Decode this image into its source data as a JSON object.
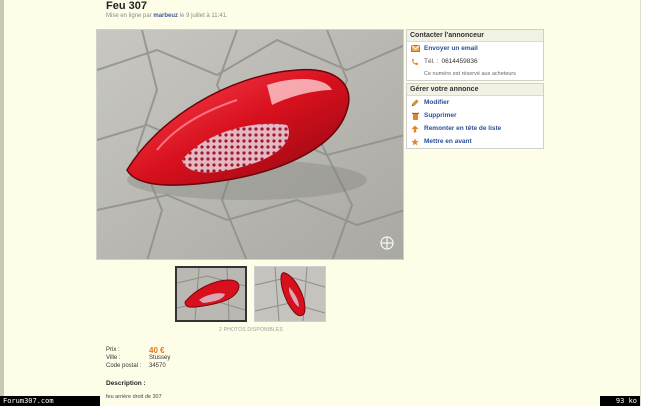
{
  "ad": {
    "title": "Feu 307",
    "meta_prefix": "Mise en ligne par",
    "seller": "marbeuz",
    "meta_suffix": "le 9 juillet à 11:41.",
    "photos_count": "2 PHOTOS DISPONIBLES"
  },
  "contact": {
    "heading": "Contacter l'annonceur",
    "email_label": "Envoyer un email",
    "phone_label": "Tél. :",
    "phone_number": "0614459836",
    "note": "Ce numéro est réservé aux acheteurs"
  },
  "manage": {
    "heading": "Gérer votre annonce",
    "items": [
      {
        "label": "Modifier",
        "icon": "pencil-icon"
      },
      {
        "label": "Supprimer",
        "icon": "trash-icon"
      },
      {
        "label": "Remonter en tête de liste",
        "icon": "up-arrow-icon"
      },
      {
        "label": "Mettre en avant",
        "icon": "star-icon"
      }
    ]
  },
  "details": {
    "price_label": "Prix :",
    "price_value": "40 €",
    "city_label": "Ville :",
    "city_value": "Stussey",
    "postal_label": "Code postal :",
    "postal_value": "34570",
    "description_label": "Description :",
    "description_text": "feu arrière droit de 307"
  },
  "footer": {
    "site": "Forum307.com",
    "size": "93 ko"
  },
  "colors": {
    "background": "#fefee8",
    "link": "#2d4f96",
    "price": "#e8791e"
  }
}
